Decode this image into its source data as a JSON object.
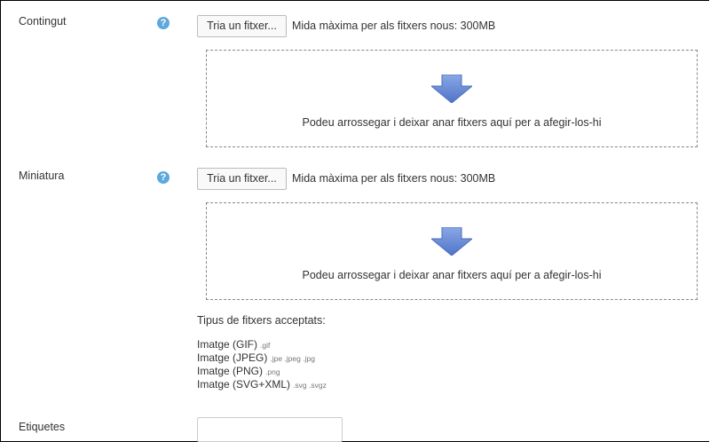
{
  "form": {
    "content": {
      "label": "Contingut",
      "button_label": "Tria un fitxer...",
      "max_size": "Mida màxima per als fitxers nous: 300MB",
      "drop_text": "Podeu arrossegar i deixar anar fitxers aquí per a afegir-los-hi"
    },
    "thumbnail": {
      "label": "Miniatura",
      "button_label": "Tria un fitxer...",
      "max_size": "Mida màxima per als fitxers nous: 300MB",
      "drop_text": "Podeu arrossegar i deixar anar fitxers aquí per a afegir-los-hi"
    },
    "accepted": {
      "title": "Tipus de fitxers acceptats:",
      "types": [
        {
          "name": "Imatge (GIF)",
          "ext": ".gif"
        },
        {
          "name": "Imatge (JPEG)",
          "ext": ".jpe .jpeg .jpg"
        },
        {
          "name": "Imatge (PNG)",
          "ext": ".png"
        },
        {
          "name": "Imatge (SVG+XML)",
          "ext": ".svg .svgz"
        }
      ]
    },
    "tags": {
      "label": "Etiquetes",
      "value": ""
    }
  },
  "help_icon_glyph": "?",
  "colors": {
    "help_icon": "#5da8dc",
    "arrow": "#6b8fd6"
  }
}
